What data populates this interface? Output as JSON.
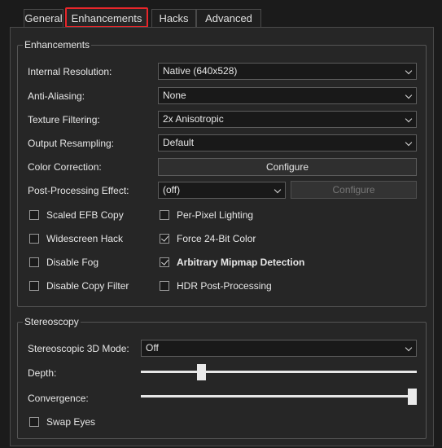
{
  "tabs": [
    {
      "label": "General"
    },
    {
      "label": "Enhancements"
    },
    {
      "label": "Hacks"
    },
    {
      "label": "Advanced"
    }
  ],
  "enhancements": {
    "title": "Enhancements",
    "internal_resolution": {
      "label": "Internal Resolution:",
      "value": "Native (640x528)"
    },
    "anti_aliasing": {
      "label": "Anti-Aliasing:",
      "value": "None"
    },
    "texture_filtering": {
      "label": "Texture Filtering:",
      "value": "2x Anisotropic"
    },
    "output_resampling": {
      "label": "Output Resampling:",
      "value": "Default"
    },
    "color_correction": {
      "label": "Color Correction:",
      "button": "Configure"
    },
    "post_processing": {
      "label": "Post-Processing Effect:",
      "value": "(off)",
      "button": "Configure"
    },
    "checks": {
      "scaled_efb_copy": {
        "label": "Scaled EFB Copy",
        "checked": false
      },
      "per_pixel_lighting": {
        "label": "Per-Pixel Lighting",
        "checked": false
      },
      "widescreen_hack": {
        "label": "Widescreen Hack",
        "checked": false
      },
      "force_24bit_color": {
        "label": "Force 24-Bit Color",
        "checked": true
      },
      "disable_fog": {
        "label": "Disable Fog",
        "checked": false
      },
      "arbitrary_mipmap": {
        "label": "Arbitrary Mipmap Detection",
        "checked": true
      },
      "disable_copy_filter": {
        "label": "Disable Copy Filter",
        "checked": false
      },
      "hdr_post_processing": {
        "label": "HDR Post-Processing",
        "checked": false
      }
    }
  },
  "stereoscopy": {
    "title": "Stereoscopy",
    "mode": {
      "label": "Stereoscopic 3D Mode:",
      "value": "Off"
    },
    "depth": {
      "label": "Depth:",
      "level": 0.21
    },
    "convergence": {
      "label": "Convergence:",
      "level": 1.0
    },
    "swap_eyes": {
      "label": "Swap Eyes",
      "checked": false
    }
  },
  "colors": {
    "active_tab_highlight": "#e8262a",
    "background": "#1b1b1b",
    "panel": "#262626"
  }
}
